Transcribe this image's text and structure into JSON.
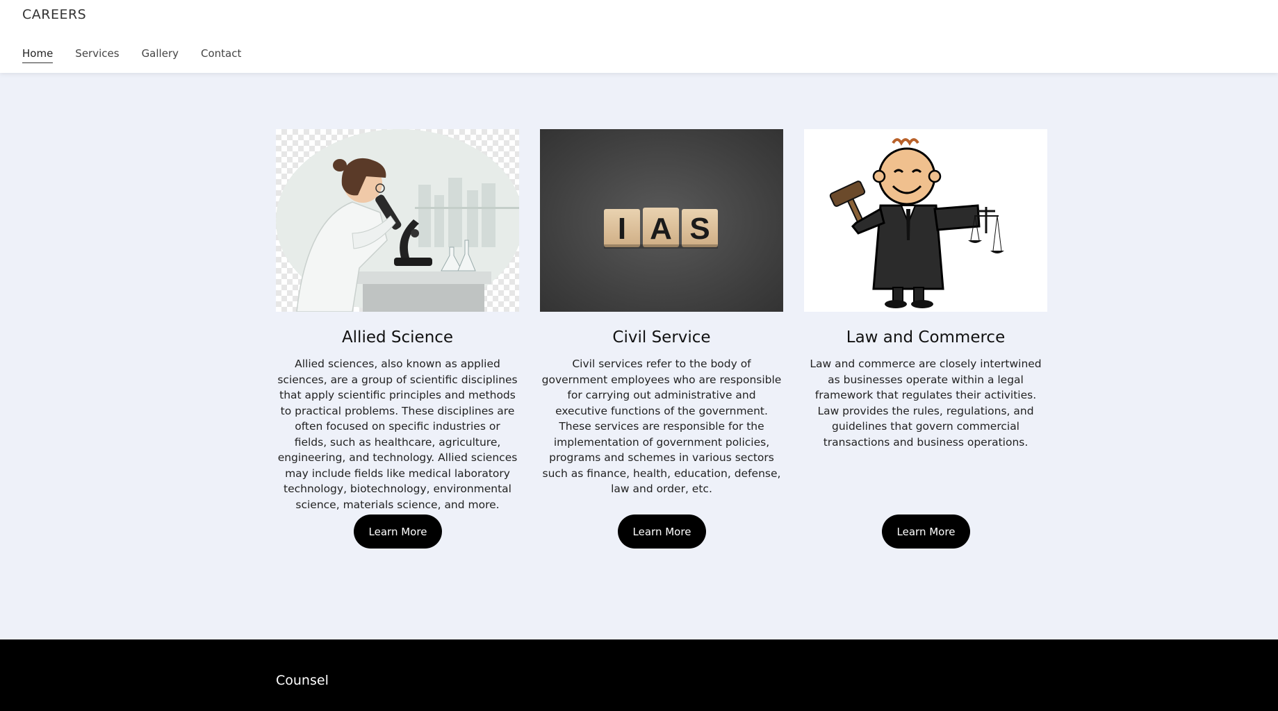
{
  "header": {
    "brand": "CAREERS",
    "nav": [
      {
        "label": "Home",
        "active": true
      },
      {
        "label": "Services",
        "active": false
      },
      {
        "label": "Gallery",
        "active": false
      },
      {
        "label": "Contact",
        "active": false
      }
    ]
  },
  "cards": [
    {
      "image": "scientist-with-microscope-illustration",
      "title": "Allied Science",
      "text": "Allied sciences, also known as applied sciences, are a group of scientific disciplines that apply scientific principles and methods to practical problems. These disciplines are often focused on specific industries or fields, such as healthcare, agriculture, engineering, and technology. Allied sciences may include fields like medical laboratory technology, biotechnology, environmental science, materials science, and more.",
      "button": "Learn More"
    },
    {
      "image": "wooden-blocks-ias-photo",
      "image_text": [
        "I",
        "A",
        "S"
      ],
      "title": "Civil Service",
      "text": "Civil services refer to the body of government employees who are responsible for carrying out administrative and executive functions of the government. These services are responsible for the implementation of government policies, programs and schemes in various sectors such as finance, health, education, defense, law and order, etc.",
      "button": "Learn More"
    },
    {
      "image": "cartoon-judge-with-gavel-and-scales",
      "title": "Law and Commerce",
      "text": "Law and commerce are closely intertwined as businesses operate within a legal framework that regulates their activities. Law provides the rules, regulations, and guidelines that govern commercial transactions and business operations.",
      "button": "Learn More"
    }
  ],
  "footer": {
    "title": "Counsel"
  },
  "colors": {
    "page_bg": "#eef1f9",
    "header_bg": "#ffffff",
    "button_bg": "#000000",
    "footer_bg": "#000000"
  }
}
